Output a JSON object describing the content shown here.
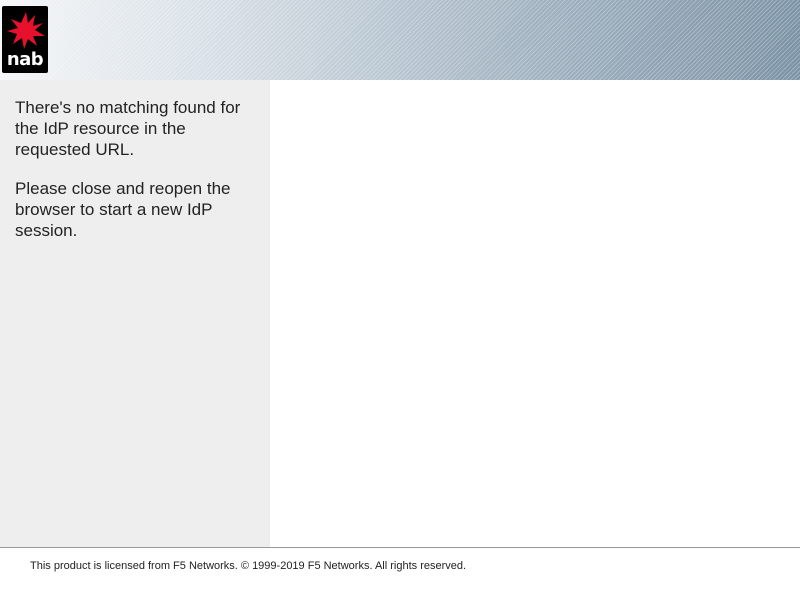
{
  "header": {
    "logo_text": "nab",
    "logo_icon": "nab-star-icon",
    "logo_star_color": "#e8112d"
  },
  "sidebar": {
    "message_1": "There's no matching found for the IdP resource in the requested URL.",
    "message_2": "Please close and reopen the browser to start a new IdP session."
  },
  "footer": {
    "text": "This product is licensed from F5 Networks. © 1999-2019 F5 Networks. All rights reserved."
  }
}
